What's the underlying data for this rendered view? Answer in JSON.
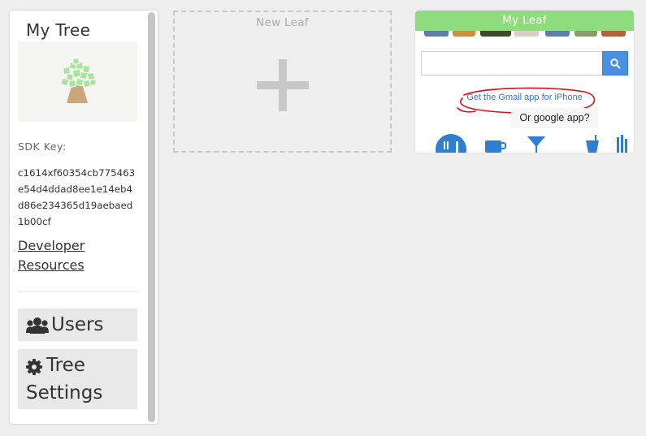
{
  "sidebar": {
    "tree_title": "My Tree",
    "logo_icon": "tree-icon",
    "sdk_label": "SDK Key:",
    "sdk_key": "c1614xf60354cb775463e54d4ddad8ee1e14eb4d86e234365d19aebaed1b00cf",
    "developer_resources": "Developer Resources",
    "users": {
      "icon": "users-icon",
      "label": "Users"
    },
    "tree_settings": {
      "icon": "gear-icon",
      "label": "Tree Settings"
    }
  },
  "new_leaf": {
    "label": "New Leaf",
    "icon": "plus-icon"
  },
  "my_leaf": {
    "title": "My Leaf",
    "header_color": "#8fdc7c",
    "search_icon": "search-icon",
    "gmail_link": "Get the Gmail app for iPhone",
    "annotation": "Or google app?",
    "annotation_color": "#d9141a",
    "category_icons": [
      "restaurant-icon",
      "coffee-icon",
      "bar-icon",
      "drink-icon",
      "more-icon"
    ]
  }
}
